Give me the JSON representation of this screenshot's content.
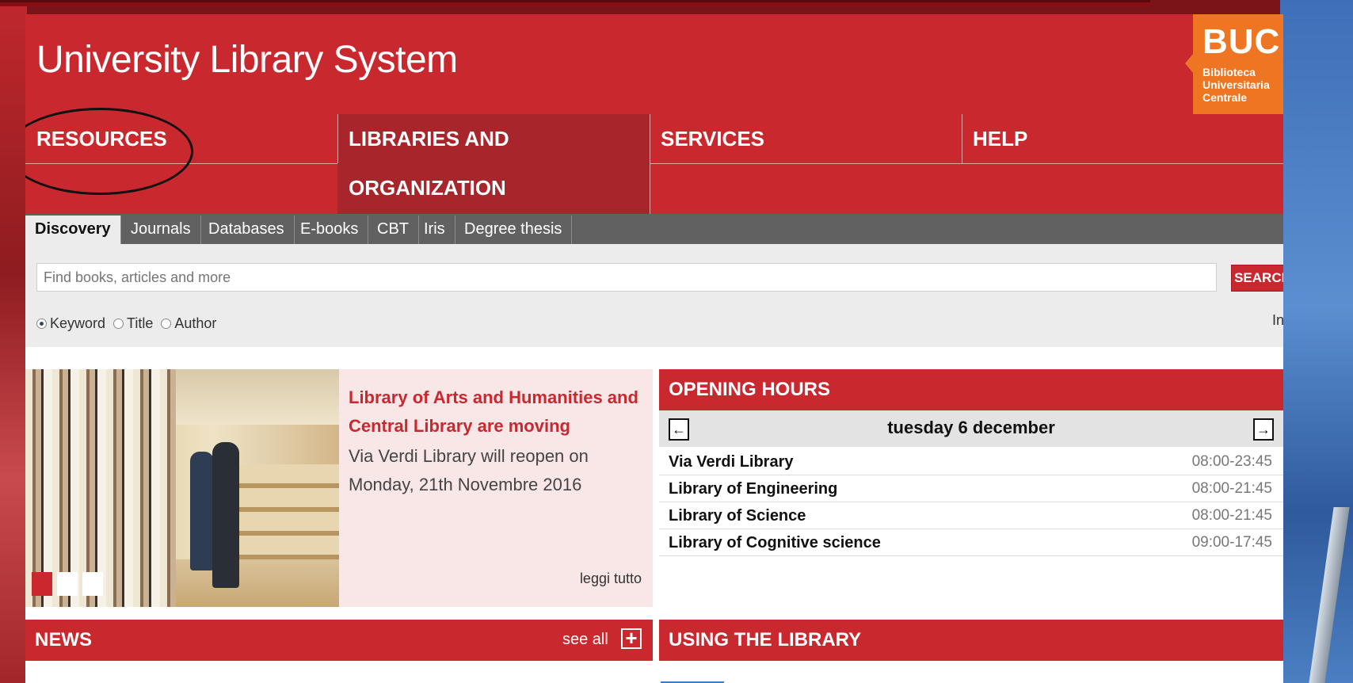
{
  "header": {
    "title": "University Library System",
    "logo": {
      "main": "BUC",
      "sub": "Biblioteca\nUniversitaria\nCentrale"
    }
  },
  "mainnav": {
    "items": [
      {
        "label": "RESOURCES"
      },
      {
        "label": "LIBRARIES AND ORGANIZATION"
      },
      {
        "label": "SERVICES"
      },
      {
        "label": "HELP"
      }
    ]
  },
  "search": {
    "tabs": [
      "Discovery",
      "Journals",
      "Databases",
      "E-books",
      "CBT",
      "Iris",
      "Degree thesis"
    ],
    "active_tab": "Discovery",
    "placeholder": "Find books, articles and more",
    "button_label": "SEARCH",
    "options": [
      "Keyword",
      "Title",
      "Author"
    ],
    "selected_option": "Keyword",
    "info_label": "Info"
  },
  "feature": {
    "title": "Library of Arts and Humanities and Central Library are moving",
    "body": "Via Verdi Library will reopen on Monday, 21th Novembre 2016",
    "more_label": "leggi tutto"
  },
  "news": {
    "title": "NEWS",
    "see_all_label": "see all"
  },
  "hours": {
    "title": "OPENING HOURS",
    "date": "tuesday 6 december",
    "rows": [
      {
        "name": "Via Verdi Library",
        "time": "08:00-23:45"
      },
      {
        "name": "Library of Engineering",
        "time": "08:00-21:45"
      },
      {
        "name": "Library of Science",
        "time": "08:00-21:45"
      },
      {
        "name": "Library of Cognitive science",
        "time": "09:00-17:45"
      }
    ]
  },
  "using": {
    "title": "USING THE LIBRARY"
  },
  "colors": {
    "brand_red": "#c8282e",
    "logo_orange": "#ee7622",
    "tab_bar": "#616161"
  },
  "icons": [
    "plus-icon",
    "arrow-left-icon",
    "arrow-right-icon"
  ]
}
